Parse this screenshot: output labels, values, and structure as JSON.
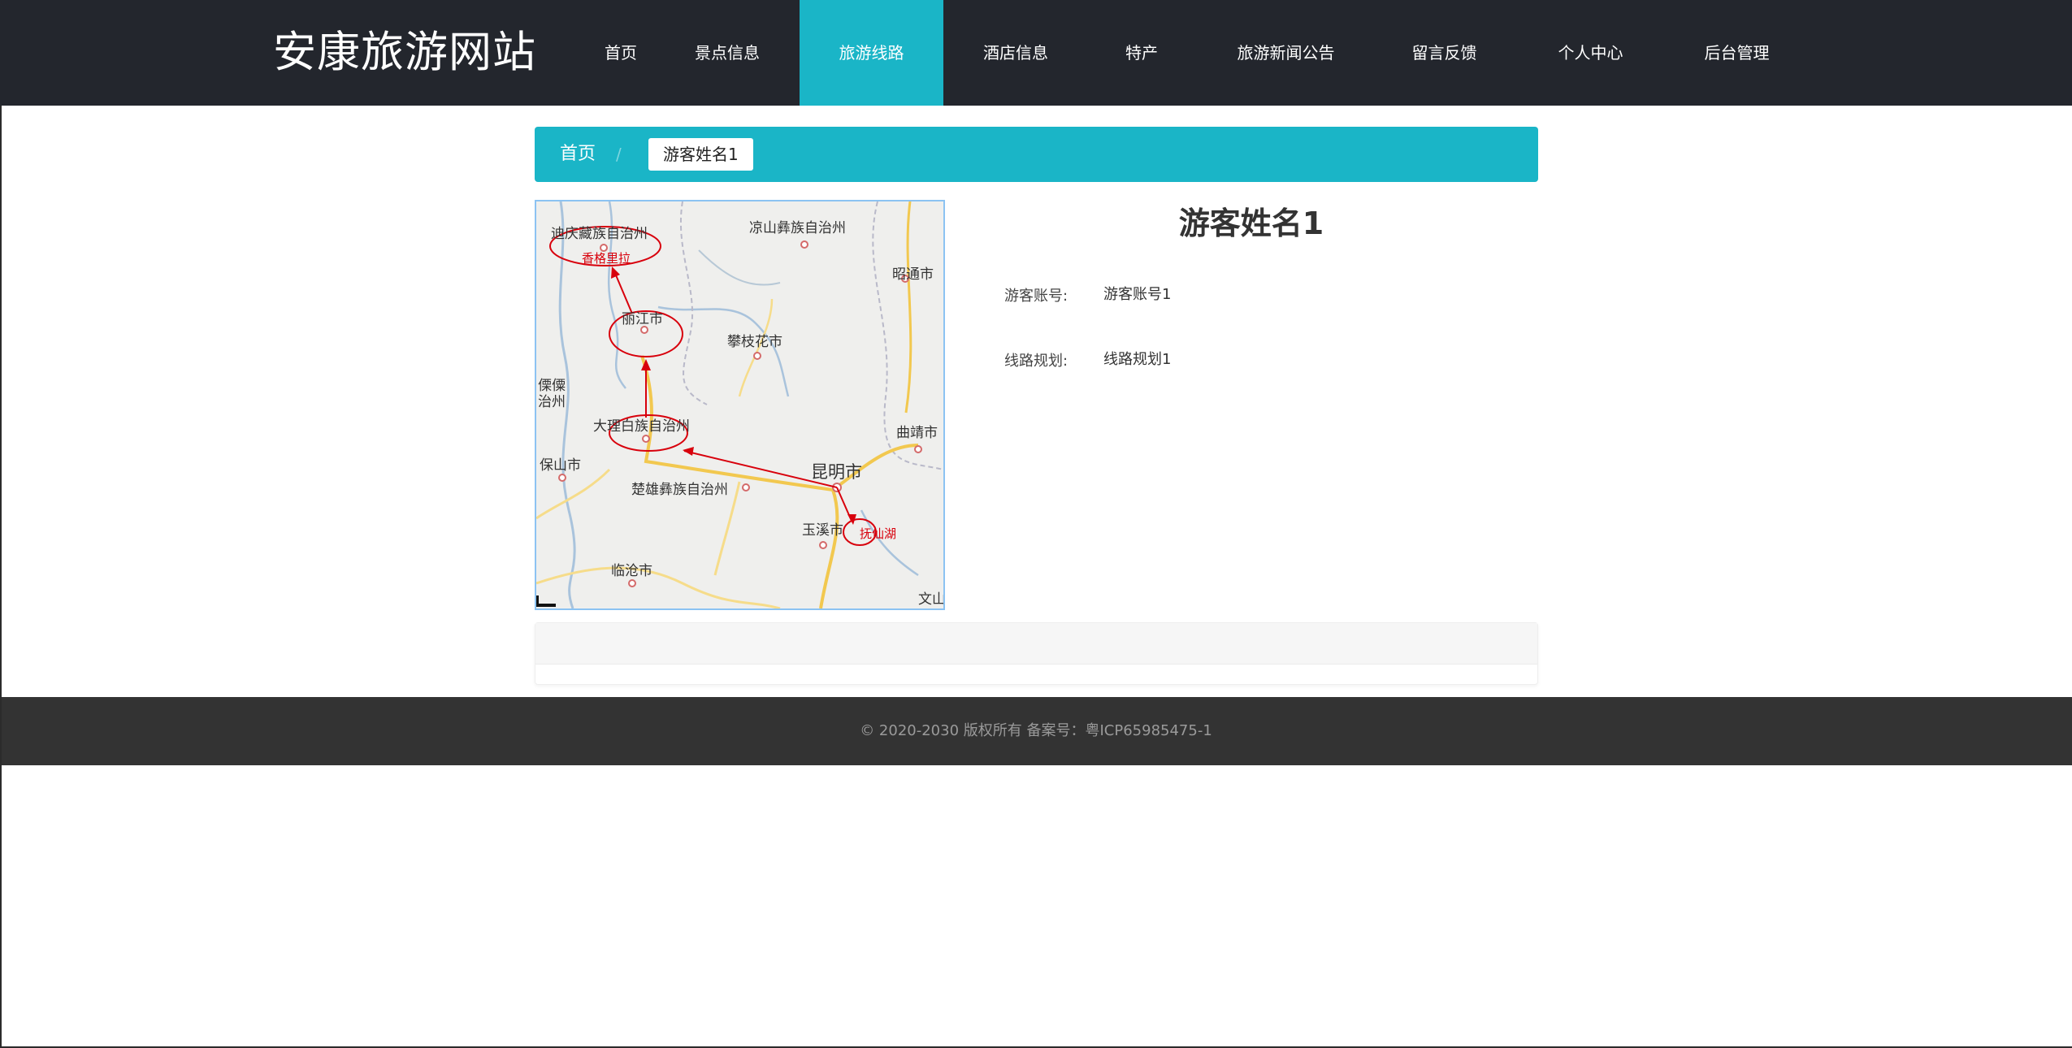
{
  "header": {
    "site_title": "安康旅游网站",
    "nav": [
      {
        "label": "首页"
      },
      {
        "label": "景点信息"
      },
      {
        "label": "旅游线路",
        "active": true
      },
      {
        "label": "酒店信息"
      },
      {
        "label": "特产"
      },
      {
        "label": "旅游新闻公告"
      },
      {
        "label": "留言反馈"
      },
      {
        "label": "个人中心"
      },
      {
        "label": "后台管理"
      }
    ]
  },
  "breadcrumb": {
    "home": "首页",
    "separator": "/",
    "current": "游客姓名1"
  },
  "map": {
    "labels": {
      "diqing": "迪庆藏族自治州",
      "shangrila": "香格里拉",
      "liangshan": "凉山彝族自治州",
      "zhaotong": "昭通市",
      "lijiang": "丽江市",
      "panzhihua": "攀枝花市",
      "lisu": "傈僳",
      "zizhizhou": "治州",
      "dali": "大理白族自治州",
      "qujing": "曲靖市",
      "baoshan": "保山市",
      "kunming": "昆明市",
      "chuxiong": "楚雄彝族自治州",
      "yuxi": "玉溪市",
      "fuxianhu": "抚仙湖",
      "lincang": "临沧市",
      "wenshan": "文山"
    }
  },
  "detail": {
    "title": "游客姓名1",
    "fields": [
      {
        "label": "游客账号:",
        "value": "游客账号1"
      },
      {
        "label": "线路规划:",
        "value": "线路规划1"
      }
    ]
  },
  "footer": {
    "copyright": "© 2020-2030 版权所有 备案号：粤ICP65985475-1"
  },
  "colors": {
    "header_bg": "#23262d",
    "accent": "#1ab5c7",
    "footer_bg": "#333333"
  }
}
